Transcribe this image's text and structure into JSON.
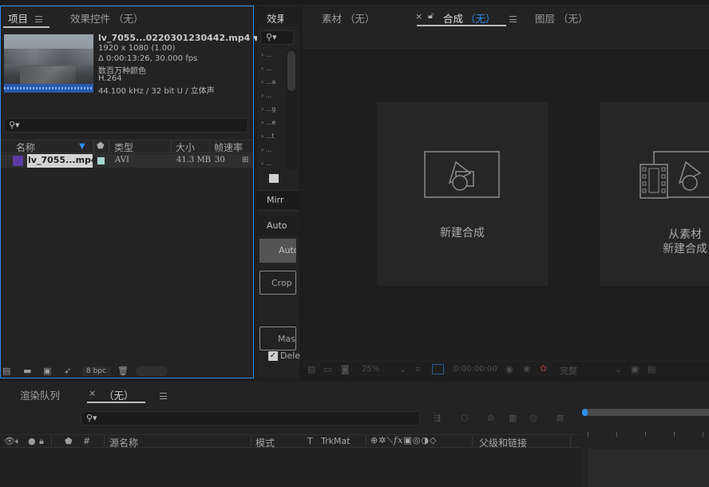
{
  "project_panel": {
    "tab_project": "项目",
    "tab_effects": "效果控件 （无）",
    "file": {
      "name": "lv_7055...0220301230442.mp4",
      "dimensions": "1920 x 1080 (1.00)",
      "duration": "Δ 0:00:13:26, 30.000 fps",
      "colors": "数百万种颜色",
      "codec": "H.264",
      "audio": "44.100 kHz / 32 bit U / 立体声"
    },
    "columns": {
      "name": "名称",
      "type": "类型",
      "size": "大小",
      "fps": "帧速率"
    },
    "rows": [
      {
        "name": "lv_7055...mp4",
        "type": "AVI",
        "size": "41.3 MB",
        "fps": "30"
      }
    ],
    "bpc": "8 bpc"
  },
  "effects_panel": {
    "tab": "效果",
    "items": [
      "...",
      "...",
      "...a",
      "...",
      "...g",
      "...e",
      "...t",
      "...",
      "..."
    ],
    "section_mirror": "Mirr",
    "section_auto": "Auto",
    "btn_auto": "Auto",
    "btn_crop": "Crop D",
    "btn_mask": "Masl",
    "chk_delete": "Dele"
  },
  "viewer": {
    "tab_footage": "素材 （无）",
    "tab_comp": "合成",
    "tab_comp_state": "（无）",
    "tab_layer": "图层 （无）",
    "card_new_comp": "新建合成",
    "card_from_footage_1": "从素材",
    "card_from_footage_2": "新建合成",
    "zoom": "25%",
    "timecode": "0:00:00:00",
    "quality": "完整"
  },
  "timeline": {
    "tab_render": "渲染队列",
    "tab_comp": "（无）",
    "col_num": "#",
    "col_source": "源名称",
    "col_mode": "模式",
    "col_t": "T",
    "col_trkmat": "TrkMat",
    "col_parent": "父级和链接"
  },
  "colors": {
    "accent": "#2d8ceb",
    "bg": "#1d1d1d",
    "panel": "#232323",
    "selected_row": "#3a3a3a"
  }
}
